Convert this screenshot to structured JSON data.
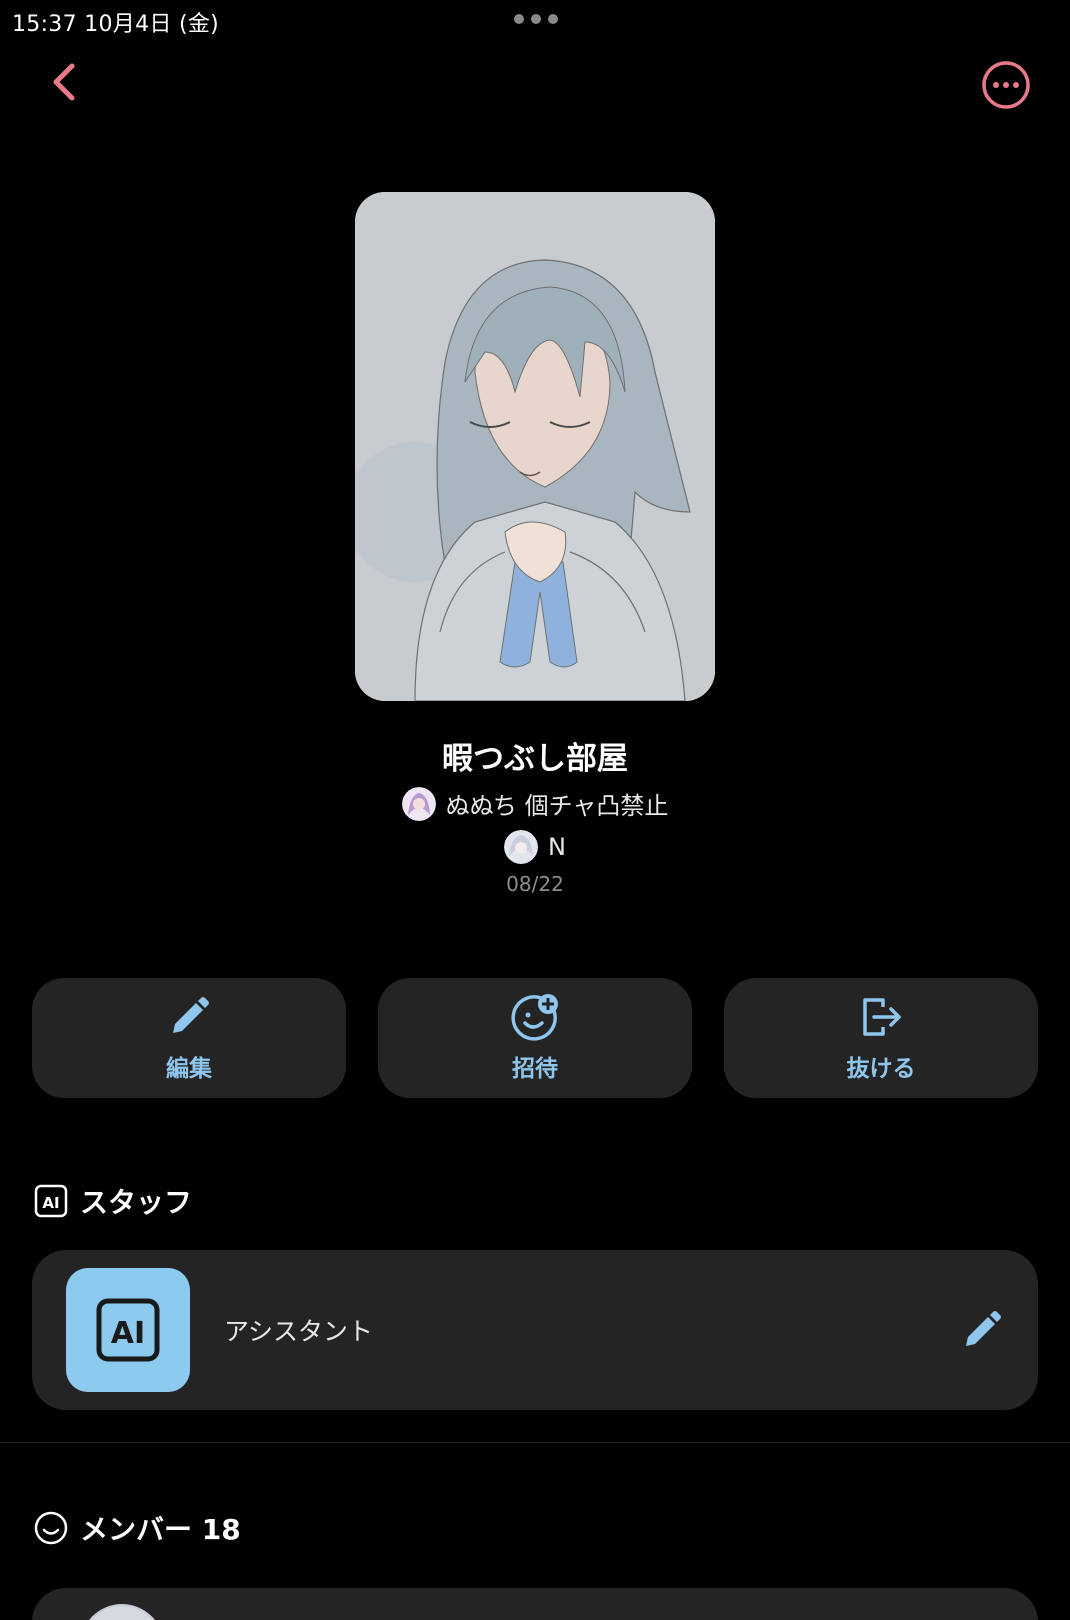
{
  "status_bar": {
    "time_date": "15:37   10月4日 (金)"
  },
  "nav": {
    "back_icon": "chevron-left-icon",
    "more_icon": "ellipsis-circle-icon",
    "accent_color": "#e8798a"
  },
  "room": {
    "title": "暇つぶし部屋",
    "owner_name": "ぬぬち 個チャ凸禁止",
    "creator_name": "N",
    "date": "08/22"
  },
  "actions": [
    {
      "label": "編集",
      "icon": "pencil-icon"
    },
    {
      "label": "招待",
      "icon": "invite-smile-plus-icon"
    },
    {
      "label": "抜ける",
      "icon": "exit-icon"
    }
  ],
  "staff_section": {
    "title": "スタッフ",
    "icon": "ai-badge-icon",
    "items": [
      {
        "name": "アシスタント",
        "avatar_text": "AI"
      }
    ]
  },
  "members_section": {
    "title": "メンバー 18",
    "icon": "smile-circle-icon"
  },
  "colors": {
    "background": "#000000",
    "card": "#242424",
    "action_label": "#8ec6ee",
    "ai_avatar_bg": "#8ccbef"
  }
}
